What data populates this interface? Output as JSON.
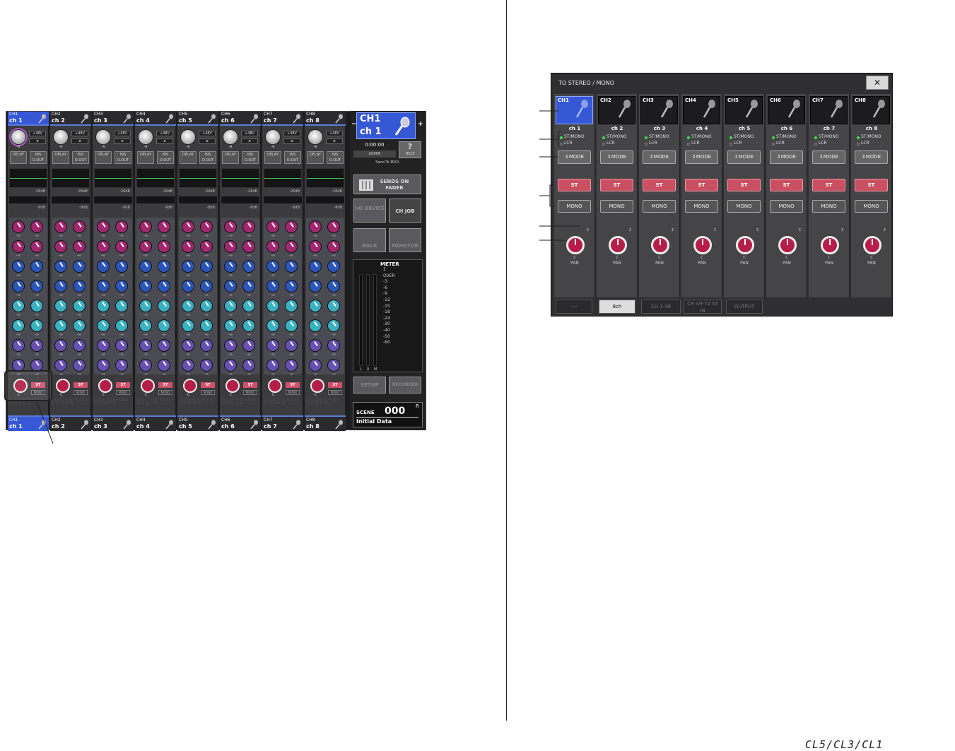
{
  "mixer": {
    "channels": [
      {
        "id": "CH1",
        "name": "ch 1",
        "gain": "-6"
      },
      {
        "id": "CH2",
        "name": "ch 2",
        "gain": "-6"
      },
      {
        "id": "CH3",
        "name": "ch 3",
        "gain": "-6"
      },
      {
        "id": "CH4",
        "name": "ch 4",
        "gain": "-6"
      },
      {
        "id": "CH5",
        "name": "ch 5",
        "gain": "-6"
      },
      {
        "id": "CH6",
        "name": "ch 6",
        "gain": "-6"
      },
      {
        "id": "CH7",
        "name": "ch 7",
        "gain": "-6"
      },
      {
        "id": "CH8",
        "name": "ch 8",
        "gain": "-6"
      }
    ],
    "phantom_label": "+48V",
    "phase_label": "ø",
    "delay_label": "DELAY",
    "ins_label": "INS",
    "dout_label": "D.OUT",
    "dyn1_value": "-26dB",
    "dyn2_value": "-8dB",
    "send_value": "-∞",
    "pan_value": "C",
    "st_label": "ST",
    "mono_label": "MONO",
    "dca_rows": "1 2 3 4 5 6 7 8 / 9 10 11 12 13 14 15 16"
  },
  "side": {
    "selected_id": "CH1",
    "selected_name": "ch 1",
    "time": "0:00:00",
    "user": "ADMIN",
    "help": "HELP",
    "send_to": "Send To MIX1",
    "sends_on_fader": "SENDS ON FADER",
    "io_device": "I/O DEVICE",
    "ch_job": "CH JOB",
    "rack": "RACK",
    "monitor": "MONITOR",
    "meter_title": "METER",
    "meter_scale": [
      "Σ",
      "OVER",
      "-3",
      "-6",
      "-9",
      "-12",
      "-15",
      "-18",
      "-24",
      "-30",
      "-40",
      "-50",
      "-60"
    ],
    "meter_labels": [
      "L",
      "R",
      "M"
    ],
    "setup": "SETUP",
    "recorder": "RECORDER",
    "scene_label": "SCENE",
    "scene_number": "000",
    "scene_flag": "R",
    "scene_title": "Initial Data"
  },
  "dialog": {
    "title": "TO STEREO / MONO",
    "close": "✕",
    "channels": [
      {
        "id": "CH1",
        "name": "ch 1"
      },
      {
        "id": "CH2",
        "name": "ch 2"
      },
      {
        "id": "CH3",
        "name": "ch 3"
      },
      {
        "id": "CH4",
        "name": "ch 4"
      },
      {
        "id": "CH5",
        "name": "ch 5"
      },
      {
        "id": "CH6",
        "name": "ch 6"
      },
      {
        "id": "CH7",
        "name": "ch 7"
      },
      {
        "id": "CH8",
        "name": "ch 8"
      }
    ],
    "mode_led1": "ST/MONO",
    "mode_led2": "LCR",
    "mode_button": "⇕MODE",
    "st_button": "ST",
    "mono_button": "MONO",
    "sigma": "Σ",
    "pan_center": "C",
    "pan_label": "PAN",
    "tabs": [
      "----",
      "8ch",
      "CH 1-48",
      "CH 49-72 ST IN",
      "OUTPUT"
    ]
  },
  "footer": {
    "logo": "CL5/CL3/CL1"
  },
  "colors": {
    "select_blue": "#3758d6",
    "st_red": "#c94f62",
    "pan_red": "#b51e48",
    "led_green": "#3fdc4f"
  }
}
